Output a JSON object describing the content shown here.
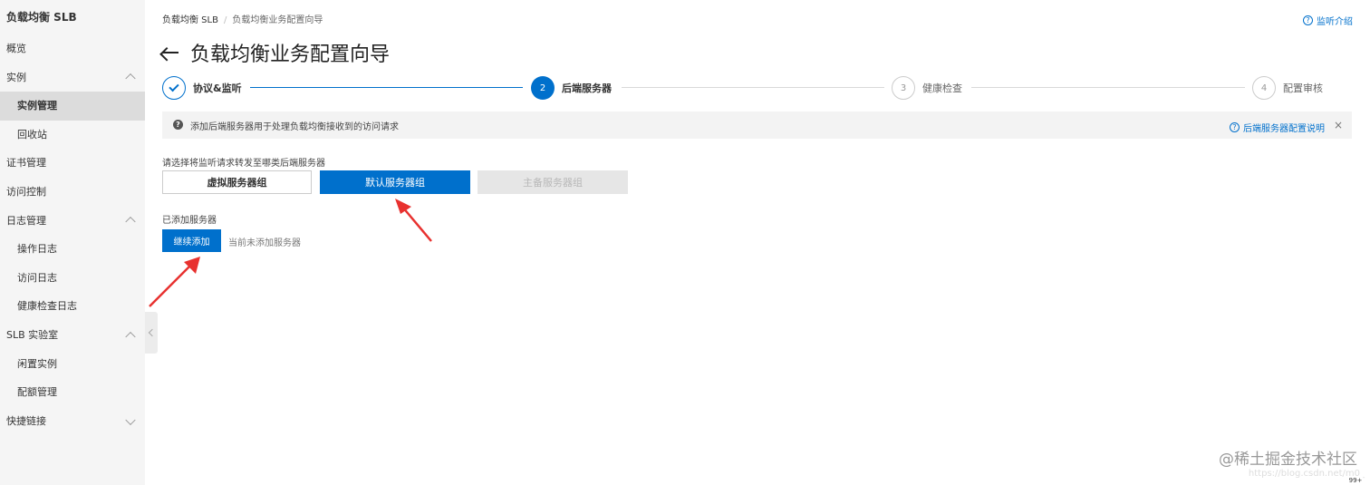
{
  "sidebar": {
    "title": "负载均衡 SLB",
    "items": [
      {
        "label": "概览"
      },
      {
        "label": "实例"
      },
      {
        "label": "实例管理"
      },
      {
        "label": "回收站"
      },
      {
        "label": "证书管理"
      },
      {
        "label": "访问控制"
      },
      {
        "label": "日志管理"
      },
      {
        "label": "操作日志"
      },
      {
        "label": "访问日志"
      },
      {
        "label": "健康检查日志"
      },
      {
        "label": "SLB 实验室"
      },
      {
        "label": "闲置实例"
      },
      {
        "label": "配额管理"
      },
      {
        "label": "快捷链接"
      }
    ]
  },
  "breadcrumb": {
    "root": "负载均衡 SLB",
    "separator": "/",
    "current": "负载均衡业务配置向导"
  },
  "header": {
    "help_link": "监听介绍",
    "title": "负载均衡业务配置向导"
  },
  "steps": [
    {
      "number": "1",
      "label": "协议&监听",
      "status": "done"
    },
    {
      "number": "2",
      "label": "后端服务器",
      "status": "active"
    },
    {
      "number": "3",
      "label": "健康检查",
      "status": "todo"
    },
    {
      "number": "4",
      "label": "配置审核",
      "status": "todo"
    }
  ],
  "notice": {
    "text": "添加后端服务器用于处理负载均衡接收到的访问请求",
    "link": "后端服务器配置说明",
    "close": "×"
  },
  "forward": {
    "label": "请选择将监听请求转发至哪类后端服务器",
    "options": [
      "虚拟服务器组",
      "默认服务器组",
      "主备服务器组"
    ],
    "selected": "默认服务器组"
  },
  "added": {
    "label": "已添加服务器",
    "add_button": "继续添加",
    "empty_text": "当前未添加服务器"
  },
  "watermark": {
    "text": "@稀土掘金技术社区",
    "url": "https://blog.csdn.net/m0_"
  },
  "corner_badge": "99+",
  "colors": {
    "primary": "#0070cc",
    "sidebar_bg": "#f5f5f5",
    "annotation_arrow": "#e8312f"
  }
}
